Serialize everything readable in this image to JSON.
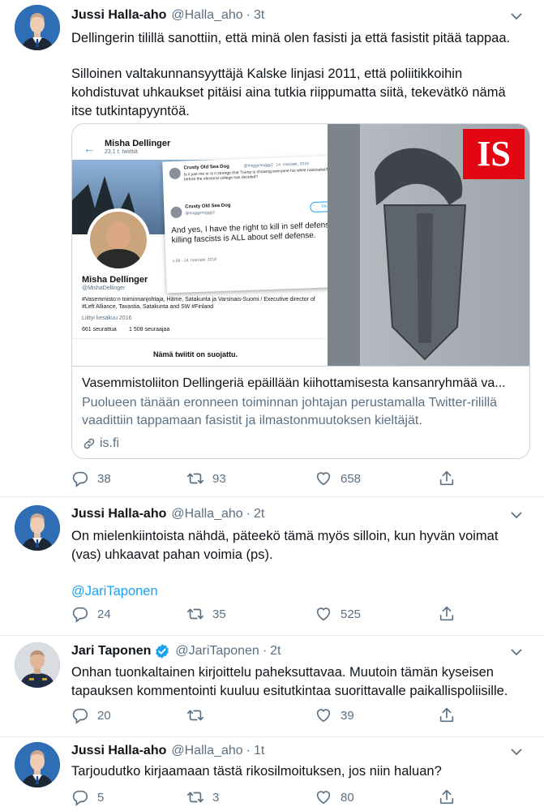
{
  "tweets": [
    {
      "name": "Jussi Halla-aho",
      "handle": "@Halla_aho",
      "time": "3t",
      "paragraph1": "Dellingerin tilillä sanottiin, että minä olen fasisti ja että fasistit pitää tappaa.",
      "paragraph2": "Silloinen valtakunnansyyttäjä Kalske linjasi 2011, että poliitikkoihin kohdistuvat uhkaukset pitäisi aina tutkia riippumatta siitä, tekevätkö nämä itse tutkintapyyntöä.",
      "card": {
        "title": "Vasemmistoliiton Dellingeriä epäillään kiihottamisesta kansanryhmää va...",
        "description": "Puolueen tänään eronneen toiminnan johtajan perustamalla Twitter-rilillä vaadittiin tappamaan fasistit ja ilmastonmuutoksen kieltäjät.",
        "domain": "is.fi",
        "image": {
          "logo": "IS",
          "profile_name": "Misha Dellinger",
          "profile_tweets": "23,1 t. twiittiä",
          "profile_handle": "@MishaDellinger",
          "profile_bio": "#Vasemmisto:n toiminnanjohtaja, Häme, Satakunta ja Varsinais-Suomi / Executive director of #Left Alliance, Tavastia, Satakunta and SW #Finland",
          "joined": "Liittyi kesäkuu 2016",
          "following": "661 seurattua",
          "followers": "1 508 seuraajaa",
          "protected": "Nämä twiitit on suojattu.",
          "quote_user": "Crusty Old Sea Dog",
          "quote_handle": "@hoggymoggy2",
          "quote_date": "14. marrask. 2018",
          "quote_text_small": "Is it just me or is it strange that Trump is showing everyone his white nationalist/fascist hand before the electoral college has decided?",
          "quote_text": "And yes, I have the right to kill in self defense and killing fascists is ALL about self defense.",
          "quote_follow": "Seuraa",
          "quote_time": "1.58 - 14. marrask. 2018"
        }
      },
      "replies": "38",
      "retweets": "93",
      "likes": "658"
    },
    {
      "name": "Jussi Halla-aho",
      "handle": "@Halla_aho",
      "time": "2t",
      "paragraph1": "On mielenkiintoista nähdä, päteekö tämä myös silloin, kun hyvän voimat (vas) uhkaavat pahan voimia (ps).",
      "mention": "@JariTaponen",
      "replies": "24",
      "retweets": "35",
      "likes": "525"
    },
    {
      "name": "Jari Taponen",
      "handle": "@JariTaponen",
      "time": "2t",
      "paragraph1": "Onhan tuonkaltainen kirjoittelu paheksuttavaa. Muutoin tämän kyseisen tapauksen kommentointi kuuluu esitutkintaa suorittavalle paikallispoliisille.",
      "replies": "20",
      "retweets": "",
      "likes": "39"
    },
    {
      "name": "Jussi Halla-aho",
      "handle": "@Halla_aho",
      "time": "1t",
      "paragraph1": "Tarjoudutko kirjaamaan tästä rikosilmoituksen, jos niin haluan?",
      "replies": "5",
      "retweets": "3",
      "likes": "80"
    }
  ],
  "dot": "·",
  "colors": {
    "accent": "#1da1f2",
    "muted": "#5b7083",
    "is_red": "#e30613"
  },
  "icons": [
    "reply-icon",
    "retweet-icon",
    "like-icon",
    "share-icon",
    "caret-down-icon",
    "verified-icon",
    "link-icon"
  ]
}
